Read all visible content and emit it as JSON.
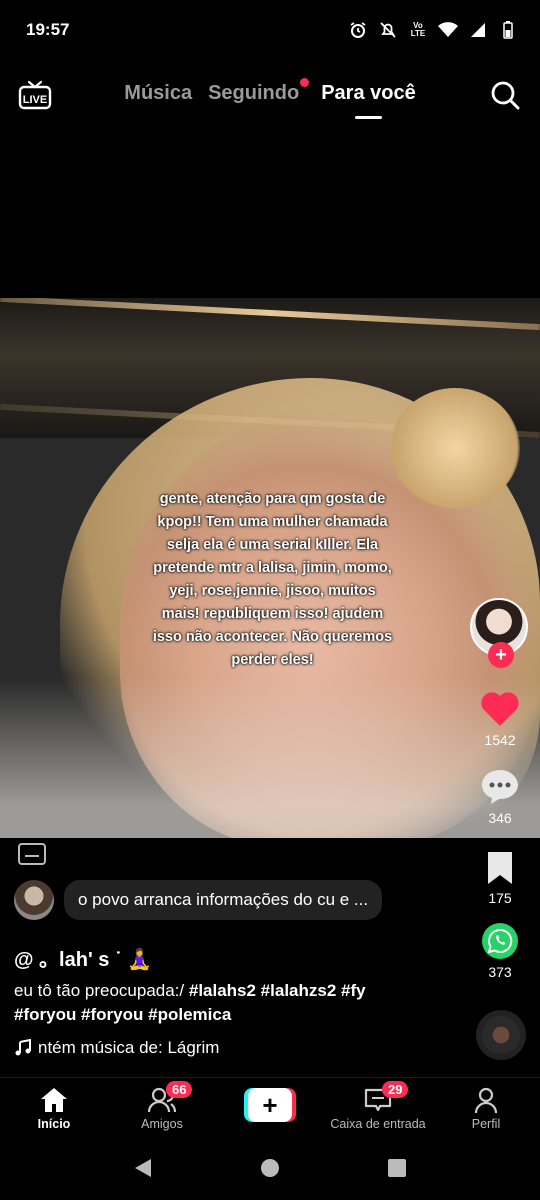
{
  "status": {
    "time": "19:57"
  },
  "header": {
    "tabs": [
      {
        "label": "Música"
      },
      {
        "label": "Seguindo"
      },
      {
        "label": "Para você"
      }
    ]
  },
  "video": {
    "caption": "gente, atenção para qm gosta de kpop!! Tem uma mulher chamada selja ela é uma serial kIller. Ela pretende mtr a lalisa, jimin, momo, yeji, rose,jennie, jisoo, muitos mais! republiquem isso! ajudem isso não acontecer. Não queremos perder eles!"
  },
  "actions": {
    "likes": "1542",
    "comments": "346",
    "saves": "175",
    "shares": "373"
  },
  "comment": {
    "text": "o povo arranca informações do cu e ..."
  },
  "post": {
    "username": "@ 。lah' s ˙ 🧘‍♀️",
    "description_text": "eu tô tão preocupada:/ ",
    "hashtags_line1": "#lalahs2 #lalahzs2 #fy",
    "hashtags_line2": "#foryou #foryou #polemica",
    "music": "ntém música de: Lágrim"
  },
  "bottom_nav": {
    "items": [
      {
        "label": "Início"
      },
      {
        "label": "Amigos",
        "badge": "66"
      },
      {
        "label": ""
      },
      {
        "label": "Caixa de entrada",
        "badge": "29"
      },
      {
        "label": "Perfil"
      }
    ]
  },
  "colors": {
    "accent": "#fe2c55",
    "accent2": "#25f4ee",
    "whatsapp": "#25d366"
  }
}
